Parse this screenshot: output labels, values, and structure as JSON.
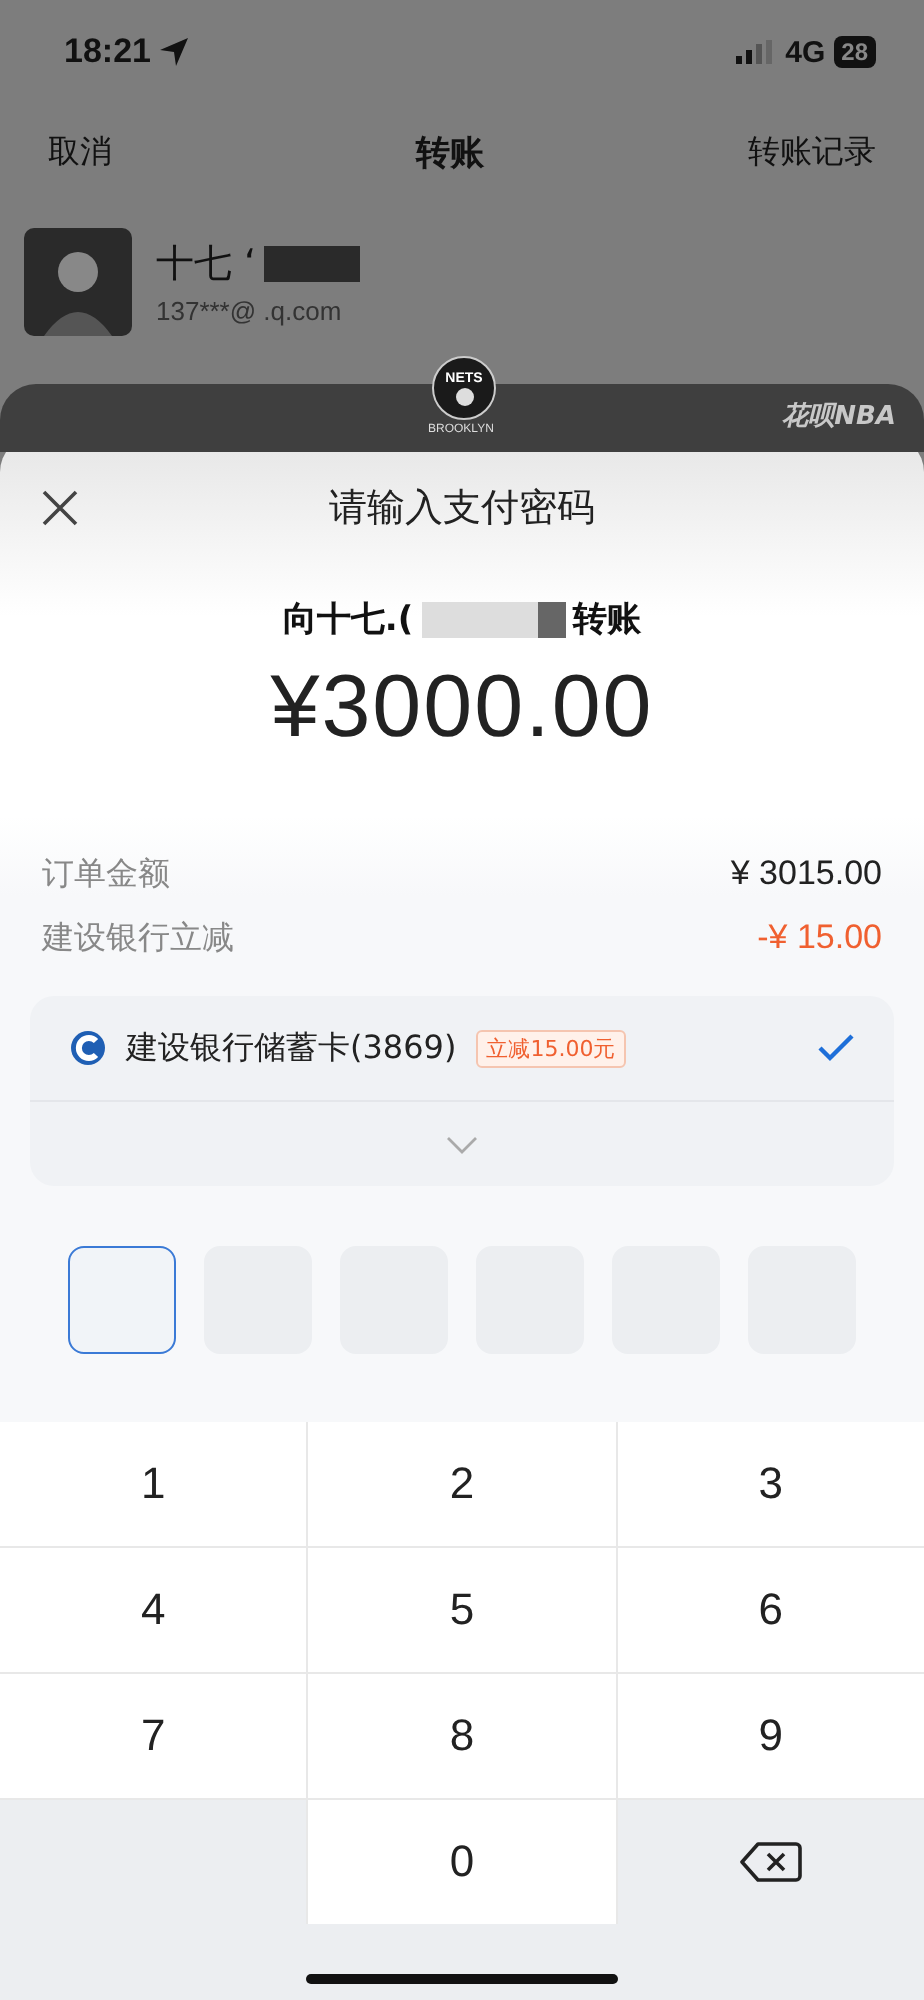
{
  "status_bar": {
    "time": "18:21",
    "network": "4G",
    "battery": "28"
  },
  "nav": {
    "left": "取消",
    "title": "转账",
    "right": "转账记录"
  },
  "contact": {
    "name": "十七 ‘",
    "account": "137***@ .q.com"
  },
  "banner": {
    "badge_top": "NETS",
    "badge_bottom": "BROOKLYN",
    "brand": "花呗NBA"
  },
  "sheet": {
    "title": "请输入支付密码",
    "recipient_before": "向十七.(",
    "recipient_after": "转账",
    "amount": "¥3000.00"
  },
  "summary": [
    {
      "label": "订单金额",
      "value": "¥ 3015.00",
      "kind": "normal"
    },
    {
      "label": "建设银行立减",
      "value": "-¥ 15.00",
      "kind": "discount"
    }
  ],
  "payment_method": {
    "name": "建设银行储蓄卡(3869)",
    "tag": "立减15.00元",
    "selected": true
  },
  "password_boxes": [
    {
      "focused": true
    },
    {
      "focused": false
    },
    {
      "focused": false
    },
    {
      "focused": false
    },
    {
      "focused": false
    },
    {
      "focused": false
    }
  ],
  "keypad": [
    {
      "kind": "digit",
      "label": "1"
    },
    {
      "kind": "digit",
      "label": "2"
    },
    {
      "kind": "digit",
      "label": "3"
    },
    {
      "kind": "digit",
      "label": "4"
    },
    {
      "kind": "digit",
      "label": "5"
    },
    {
      "kind": "digit",
      "label": "6"
    },
    {
      "kind": "digit",
      "label": "7"
    },
    {
      "kind": "digit",
      "label": "8"
    },
    {
      "kind": "digit",
      "label": "9"
    },
    {
      "kind": "blank"
    },
    {
      "kind": "digit",
      "label": "0"
    },
    {
      "kind": "backspace"
    }
  ]
}
